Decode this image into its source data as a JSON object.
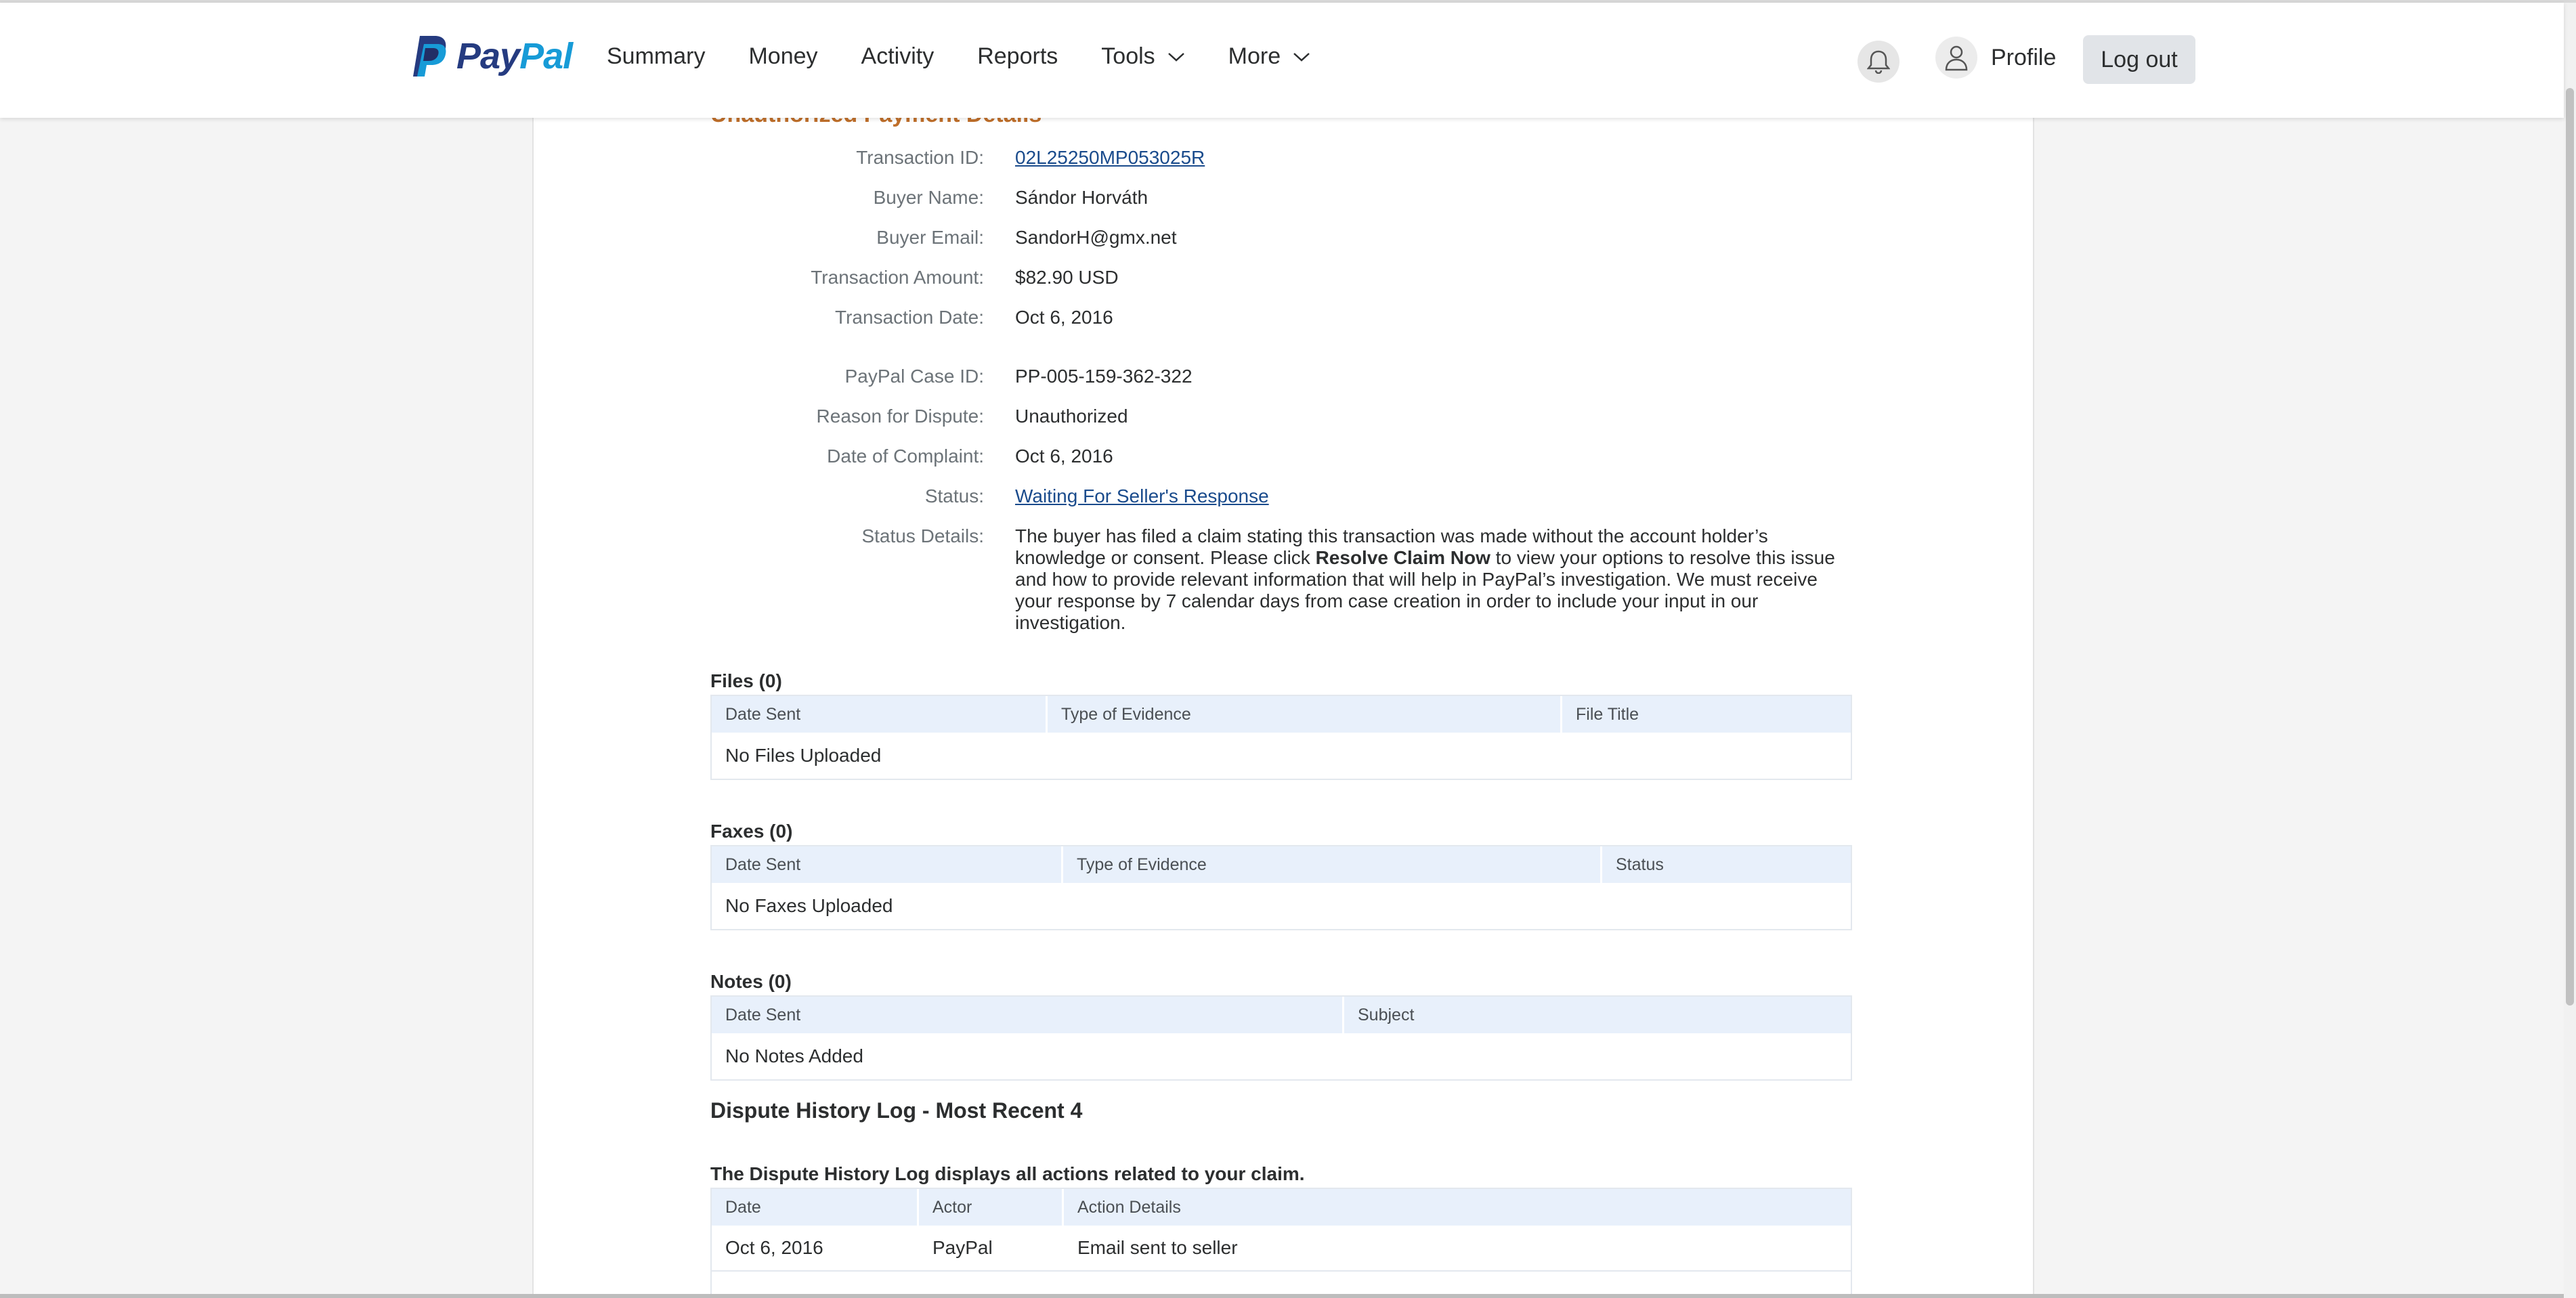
{
  "header": {
    "logo_pay": "Pay",
    "logo_pal": "Pal",
    "nav": [
      "Summary",
      "Money",
      "Activity",
      "Reports"
    ],
    "nav_dropdowns": [
      "Tools",
      "More"
    ],
    "profile_label": "Profile",
    "logout_label": "Log out",
    "icons": [
      "paypal-logo-icon",
      "bell-icon",
      "user-icon",
      "chevron-down-icon"
    ]
  },
  "section_title": "Unauthorized Payment Details",
  "details": {
    "transaction_id_label": "Transaction ID:",
    "transaction_id": "02L25250MP053025R",
    "buyer_name_label": "Buyer Name:",
    "buyer_name": "Sándor Horváth",
    "buyer_email_label": "Buyer Email:",
    "buyer_email": "SandorH@gmx.net",
    "amount_label": "Transaction Amount:",
    "amount": "$82.90 USD",
    "date_label": "Transaction Date:",
    "date": "Oct 6, 2016",
    "case_id_label": "PayPal Case ID:",
    "case_id": "PP-005-159-362-322",
    "reason_label": "Reason for Dispute:",
    "reason": "Unauthorized",
    "complaint_date_label": "Date of Complaint:",
    "complaint_date": "Oct 6, 2016",
    "status_label": "Status:",
    "status": "Waiting For Seller's Response",
    "status_details_label": "Status Details:",
    "status_details_1": "The buyer has filed a claim stating this transaction was made without the account holder’s knowledge or consent. Please click ",
    "status_details_bold": "Resolve Claim Now",
    "status_details_2": " to view your options to resolve this issue and how to provide relevant information that will help in PayPal’s investigation. We must receive your response by 7 calendar days from case creation in order to include your input in our investigation."
  },
  "files": {
    "title": "Files (0)",
    "columns": [
      "Date Sent",
      "Type of Evidence",
      "File Title"
    ],
    "empty": "No Files Uploaded"
  },
  "faxes": {
    "title": "Faxes (0)",
    "columns": [
      "Date Sent",
      "Type of Evidence",
      "Status"
    ],
    "empty": "No Faxes Uploaded"
  },
  "notes": {
    "title": "Notes (0)",
    "columns": [
      "Date Sent",
      "Subject"
    ],
    "empty": "No Notes Added"
  },
  "history": {
    "title": "Dispute History Log - Most Recent 4",
    "subtitle": "The Dispute History Log displays all actions related to your claim.",
    "columns": [
      "Date",
      "Actor",
      "Action Details"
    ],
    "rows": [
      {
        "date": "Oct 6, 2016",
        "actor": "PayPal",
        "action": "Email sent to seller"
      }
    ]
  }
}
